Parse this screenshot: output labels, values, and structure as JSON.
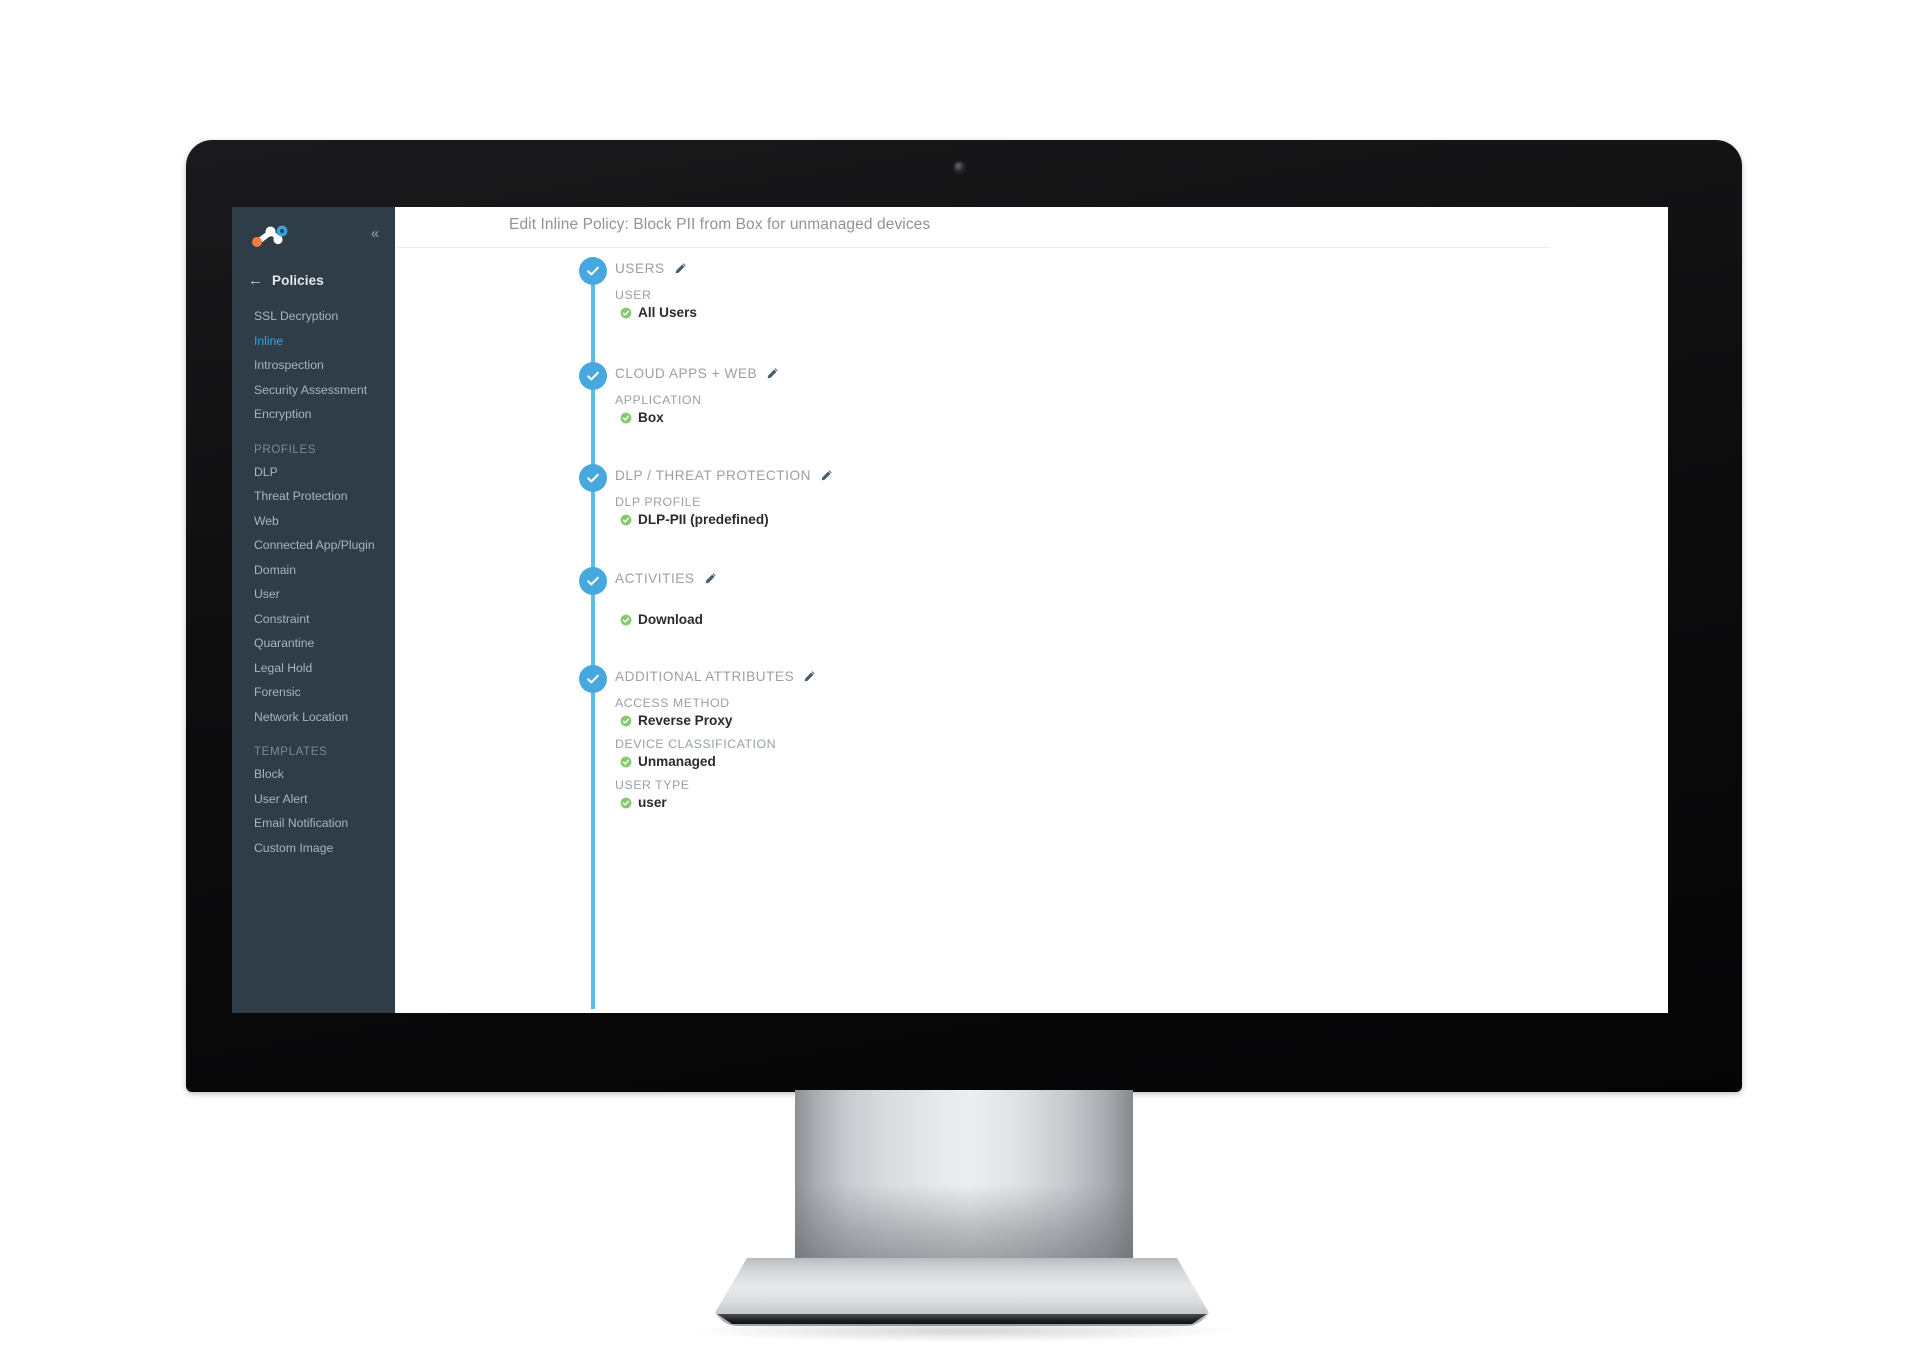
{
  "device": {
    "type": "desktop-monitor",
    "camera": "webcam-dot"
  },
  "app": {
    "header": {
      "title": "Edit Inline Policy: Block PII from Box for unmanaged devices"
    },
    "sidebar": {
      "logo_name": "netskope-molecule-logo",
      "collapse_label": "«",
      "back_arrow": "←",
      "back_label": "Policies",
      "groups": [
        {
          "section": null,
          "items": [
            {
              "label": "SSL Decryption",
              "active": false
            },
            {
              "label": "Inline",
              "active": true
            },
            {
              "label": "Introspection",
              "active": false
            },
            {
              "label": "Security Assessment",
              "active": false
            },
            {
              "label": "Encryption",
              "active": false
            }
          ]
        },
        {
          "section": "PROFILES",
          "items": [
            {
              "label": "DLP",
              "active": false
            },
            {
              "label": "Threat Protection",
              "active": false
            },
            {
              "label": "Web",
              "active": false
            },
            {
              "label": "Connected App/Plugin",
              "active": false
            },
            {
              "label": "Domain",
              "active": false
            },
            {
              "label": "User",
              "active": false
            },
            {
              "label": "Constraint",
              "active": false
            },
            {
              "label": "Quarantine",
              "active": false
            },
            {
              "label": "Legal Hold",
              "active": false
            },
            {
              "label": "Forensic",
              "active": false
            },
            {
              "label": "Network Location",
              "active": false
            }
          ]
        },
        {
          "section": "TEMPLATES",
          "items": [
            {
              "label": "Block",
              "active": false
            },
            {
              "label": "User Alert",
              "active": false
            },
            {
              "label": "Email Notification",
              "active": false
            },
            {
              "label": "Custom Image",
              "active": false
            }
          ]
        }
      ]
    },
    "policy_steps": [
      {
        "title": "USERS",
        "edit_icon": "pencil-icon",
        "status": "complete",
        "fields": [
          {
            "label": "USER",
            "values": [
              "All Users"
            ]
          }
        ]
      },
      {
        "title": "CLOUD APPS + WEB",
        "edit_icon": "pencil-icon",
        "status": "complete",
        "fields": [
          {
            "label": "APPLICATION",
            "values": [
              "Box"
            ]
          }
        ]
      },
      {
        "title": "DLP / THREAT PROTECTION",
        "edit_icon": "pencil-icon",
        "status": "complete",
        "fields": [
          {
            "label": "DLP PROFILE",
            "values": [
              "DLP-PII (predefined)"
            ]
          }
        ]
      },
      {
        "title": "ACTIVITIES",
        "edit_icon": "pencil-icon",
        "status": "complete",
        "fields": [
          {
            "label": "",
            "values": [
              "Download"
            ]
          }
        ]
      },
      {
        "title": "ADDITIONAL ATTRIBUTES",
        "edit_icon": "pencil-icon",
        "status": "complete",
        "fields": [
          {
            "label": "ACCESS METHOD",
            "values": [
              "Reverse Proxy"
            ]
          },
          {
            "label": "DEVICE CLASSIFICATION",
            "values": [
              "Unmanaged"
            ]
          },
          {
            "label": "USER TYPE",
            "values": [
              "user"
            ]
          }
        ]
      }
    ],
    "colors": {
      "sidebar_bg": "#2f3d48",
      "accent_blue": "#46a8de",
      "active_nav": "#2fa8e0",
      "track_blue": "#5dbbe4",
      "check_green": "#74c365",
      "title_grey": "#8e949a"
    }
  }
}
